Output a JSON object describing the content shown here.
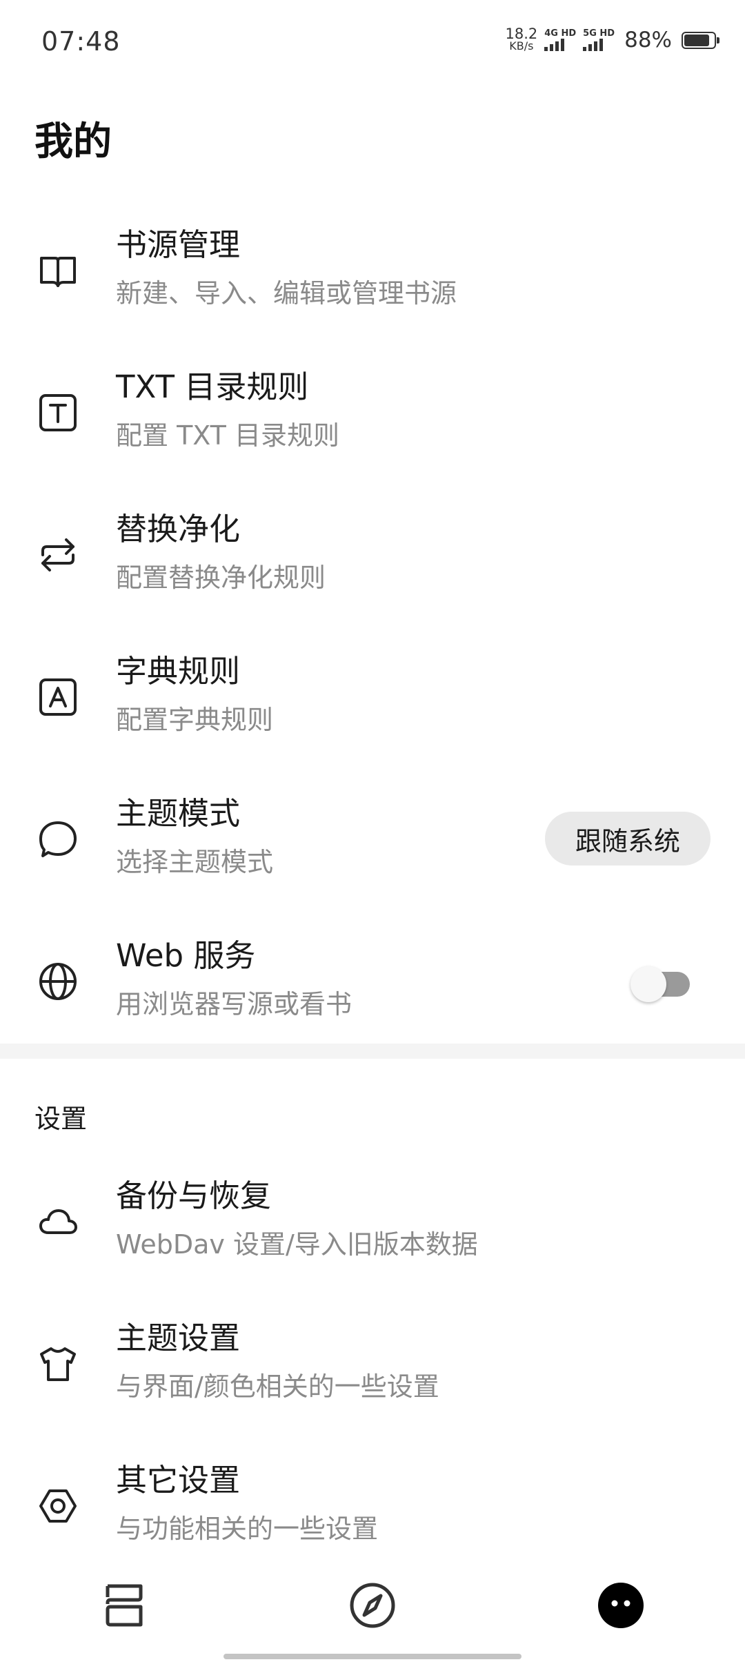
{
  "status_bar": {
    "time": "07:48",
    "net_speed_value": "18.2",
    "net_speed_unit": "KB/s",
    "sim1_label": "4G HD",
    "sim2_label": "5G HD",
    "battery_percent": "88%",
    "battery_level": 0.88
  },
  "page": {
    "title": "我的"
  },
  "menu": [
    {
      "title": "书源管理",
      "subtitle": "新建、导入、编辑或管理书源",
      "icon": "book-icon"
    },
    {
      "title": "TXT 目录规则",
      "subtitle": "配置 TXT 目录规则",
      "icon": "text-box-icon"
    },
    {
      "title": "替换净化",
      "subtitle": "配置替换净化规则",
      "icon": "swap-arrows-icon"
    },
    {
      "title": "字典规则",
      "subtitle": "配置字典规则",
      "icon": "letter-box-icon"
    },
    {
      "title": "主题模式",
      "subtitle": "选择主题模式",
      "icon": "chat-bubble-icon",
      "action_label": "跟随系统"
    },
    {
      "title": "Web 服务",
      "subtitle": "用浏览器写源或看书",
      "icon": "globe-icon",
      "toggle_on": false
    }
  ],
  "settings_section": {
    "label": "设置",
    "items": [
      {
        "title": "备份与恢复",
        "subtitle": "WebDav 设置/导入旧版本数据",
        "icon": "cloud-icon"
      },
      {
        "title": "主题设置",
        "subtitle": "与界面/颜色相关的一些设置",
        "icon": "tshirt-icon"
      },
      {
        "title": "其它设置",
        "subtitle": "与功能相关的一些设置",
        "icon": "hex-nut-icon"
      }
    ]
  },
  "bottom_nav": [
    {
      "name": "bookshelf",
      "icon": "bookshelf-icon"
    },
    {
      "name": "explore",
      "icon": "compass-icon"
    },
    {
      "name": "my",
      "icon": "face-icon",
      "active": true
    }
  ]
}
